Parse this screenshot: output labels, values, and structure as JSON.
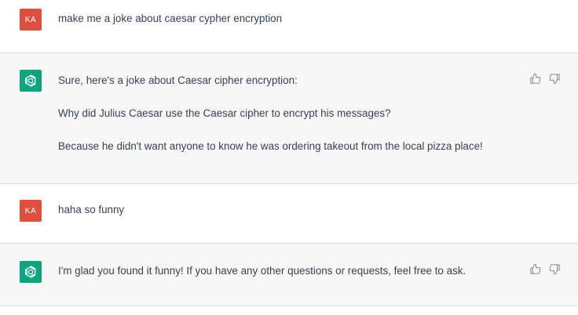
{
  "messages": [
    {
      "role": "user",
      "avatar_initials": "KA",
      "paragraphs": [
        "make me a joke about caesar cypher encryption"
      ]
    },
    {
      "role": "assistant",
      "avatar_icon": "openai-logo-icon",
      "paragraphs": [
        "Sure, here's a joke about Caesar cipher encryption:",
        "Why did Julius Caesar use the Caesar cipher to encrypt his messages?",
        "Because he didn't want anyone to know he was ordering takeout from the local pizza place!"
      ]
    },
    {
      "role": "user",
      "avatar_initials": "KA",
      "paragraphs": [
        "haha so funny"
      ]
    },
    {
      "role": "assistant",
      "avatar_icon": "openai-logo-icon",
      "paragraphs": [
        "I'm glad you found it funny! If you have any other questions or requests, feel free to ask."
      ]
    }
  ],
  "colors": {
    "user_avatar": "#df4f3f",
    "assistant_avatar": "#10a37f",
    "assistant_bg": "#f7f7f8"
  }
}
